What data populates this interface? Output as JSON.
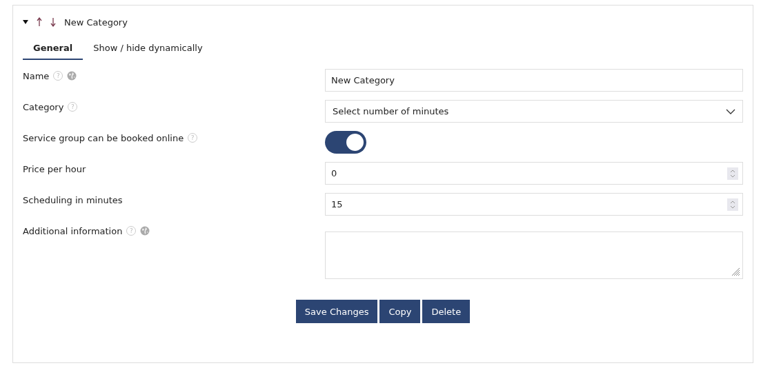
{
  "header": {
    "expanded": true,
    "title": "New Category"
  },
  "tabs": [
    {
      "label": "General",
      "selected": true
    },
    {
      "label": "Show / hide dynamically",
      "selected": false
    }
  ],
  "fields": [
    {
      "kind": "text",
      "label": "Name",
      "help": "?",
      "translatable": true,
      "value": "New Category"
    },
    {
      "kind": "select",
      "label": "Category",
      "help": "?",
      "translatable": false,
      "value": "Select number of minutes"
    },
    {
      "kind": "toggle",
      "label": "Service group can be booked online",
      "help": "?",
      "translatable": false,
      "on": true
    },
    {
      "kind": "number",
      "label": "Price per hour",
      "translatable": false,
      "value": "0"
    },
    {
      "kind": "number",
      "label": "Scheduling in minutes",
      "translatable": false,
      "value": "15"
    },
    {
      "kind": "textarea",
      "label": "Additional information",
      "help": "?",
      "translatable": true
    }
  ],
  "buttons": [
    "Save Changes",
    "Copy",
    "Delete"
  ]
}
